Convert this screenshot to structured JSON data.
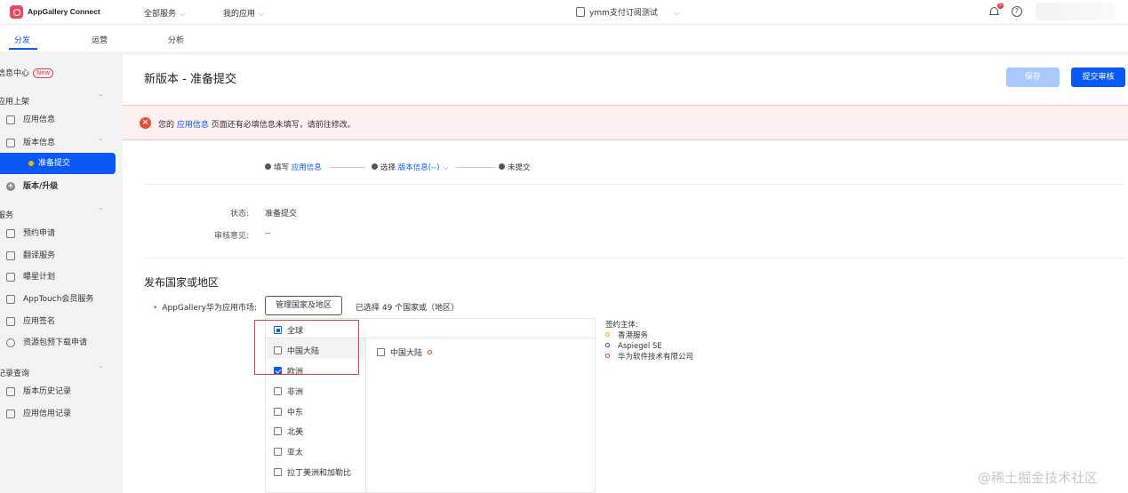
{
  "topbar": {
    "brand": "AppGallery Connect",
    "all_services": "全部服务",
    "my_apps": "我的应用",
    "current_app": "ymm支付订阅测试",
    "notification_count": "5",
    "help_glyph": "?"
  },
  "tabs": [
    {
      "label": "分发",
      "active": true
    },
    {
      "label": "运营",
      "active": false
    },
    {
      "label": "分析",
      "active": false
    }
  ],
  "sidebar": {
    "info_center": "信息中心",
    "new_badge": "New",
    "group_listing": "应用上架",
    "app_info": "应用信息",
    "version_info": "版本信息",
    "prepare_submit": "准备提交",
    "version_upgrade": "版本/升级",
    "group_services": "服务",
    "preorder": "预约申请",
    "translation": "翻译服务",
    "spotlight": "曝星计划",
    "apptouch": "AppTouch会员服务",
    "app_signing": "应用签名",
    "resource_predownload": "资源包预下载申请",
    "group_records": "记录查询",
    "version_history": "版本历史记录",
    "credit_records": "应用信用记录"
  },
  "main": {
    "title": "新版本 - 准备提交",
    "save_label": "保存",
    "submit_label": "提交审核",
    "alert_prefix": "您的",
    "alert_link": "应用信息",
    "alert_suffix": "页面还有必填信息未填写，请前往修改。",
    "step1_prefix": "填写",
    "step1_link": "应用信息",
    "step2_prefix": "选择",
    "step2_link": "版本信息(--)",
    "step3": "未提交",
    "status_key": "状态:",
    "status_val": "准备提交",
    "review_key": "审核意见:",
    "review_val": "--",
    "section_title": "发布国家或地区",
    "market_label": "AppGallery华为应用市场:",
    "manage_button": "管理国家及地区",
    "selected_count": "已选择 49 个国家或（地区）",
    "regions": [
      {
        "label": "全球",
        "state": "partial"
      },
      {
        "label": "中国大陆",
        "state": "unchecked"
      },
      {
        "label": "欧洲",
        "state": "checked"
      },
      {
        "label": "非洲",
        "state": "unchecked"
      },
      {
        "label": "中东",
        "state": "unchecked"
      },
      {
        "label": "北美",
        "state": "unchecked"
      },
      {
        "label": "亚太",
        "state": "unchecked"
      },
      {
        "label": "拉丁美洲和加勒比",
        "state": "unchecked"
      }
    ],
    "sub_region": "中国大陆",
    "signer_title": "签约主体:",
    "signers": [
      {
        "label": "香港服务",
        "color": "#f5b400"
      },
      {
        "label": "Aspiegel SE",
        "color": "#0a59f7"
      },
      {
        "label": "华为软件技术有限公司",
        "color": "#e84040"
      }
    ]
  },
  "watermark": "@稀土掘金技术社区",
  "colors": {
    "accent": "#0a59f7",
    "error": "#e84c3d",
    "warning": "#f5b400"
  }
}
